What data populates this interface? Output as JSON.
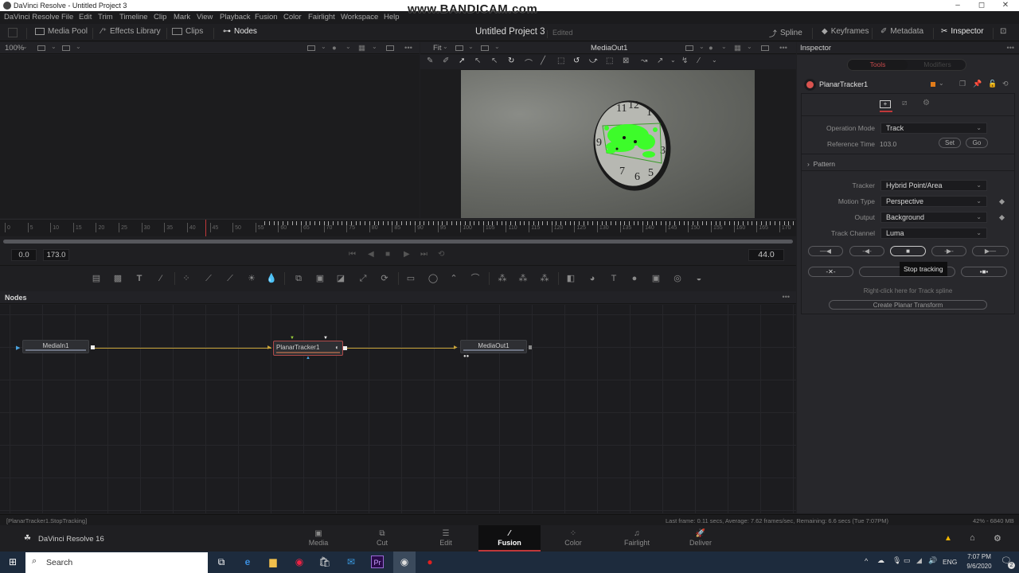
{
  "window": {
    "title": "DaVinci Resolve - Untitled Project 3",
    "watermark": "www.BANDICAM.com",
    "min": "–",
    "max": "◻",
    "close": "✕"
  },
  "menu": [
    "DaVinci Resolve",
    "File",
    "Edit",
    "Trim",
    "Timeline",
    "Clip",
    "Mark",
    "View",
    "Playback",
    "Fusion",
    "Color",
    "Fairlight",
    "Workspace",
    "Help"
  ],
  "toolbar": {
    "media_pool": "Media Pool",
    "effects_library": "Effects Library",
    "clips": "Clips",
    "nodes": "Nodes",
    "project_title": "Untitled Project 3",
    "project_status": "Edited",
    "spline": "Spline",
    "keyframes": "Keyframes",
    "metadata": "Metadata",
    "inspector": "Inspector"
  },
  "viewer_left": {
    "zoom": "100%"
  },
  "viewer_right": {
    "zoom": "Fit",
    "title": "MediaOut1"
  },
  "timeline": {
    "ticks": [
      0,
      5,
      10,
      15,
      20,
      25,
      30,
      35,
      40,
      45,
      50,
      55,
      60,
      65,
      70,
      75,
      80,
      85,
      90,
      95,
      100,
      105,
      110,
      115,
      120,
      125,
      130,
      135,
      140,
      145,
      150,
      155,
      160,
      165,
      170
    ],
    "start": "0.0",
    "end": "173.0",
    "current": "44.0"
  },
  "nodes_panel": {
    "title": "Nodes",
    "nodes": [
      {
        "name": "MediaIn1"
      },
      {
        "name": "PlanarTracker1"
      },
      {
        "name": "MediaOut1"
      }
    ]
  },
  "inspector": {
    "title": "Inspector",
    "tabs": {
      "tools": "Tools",
      "modifiers": "Modifiers"
    },
    "tool_name": "PlanarTracker1",
    "tool_color": "#e07b1a",
    "operation_mode_label": "Operation Mode",
    "operation_mode": "Track",
    "reference_time_label": "Reference Time",
    "reference_time": "103.0",
    "set": "Set",
    "go": "Go",
    "pattern": "Pattern",
    "tracker_label": "Tracker",
    "tracker": "Hybrid Point/Area",
    "motion_type_label": "Motion Type",
    "motion_type": "Perspective",
    "output_label": "Output",
    "output": "Background",
    "track_channel_label": "Track Channel",
    "track_channel": "Luma",
    "tooltip": "Stop tracking",
    "track_spline_hint": "Right-click here for Track spline",
    "create_planar_transform": "Create Planar Transform"
  },
  "status": {
    "left": "[PlanarTracker1.StopTracking]",
    "center": "Last frame: 0.11 secs, Average: 7.62 frames/sec, Remaining: 6.6 secs (Tue 7:07PM)",
    "right": "42% - 6840 MB"
  },
  "pages": {
    "brand": "DaVinci Resolve 16",
    "items": [
      "Media",
      "Cut",
      "Edit",
      "Fusion",
      "Color",
      "Fairlight",
      "Deliver"
    ],
    "active": "Fusion"
  },
  "taskbar": {
    "search": "Search",
    "lang": "ENG",
    "time": "7:07 PM",
    "date": "9/6/2020",
    "notifications": "2"
  }
}
